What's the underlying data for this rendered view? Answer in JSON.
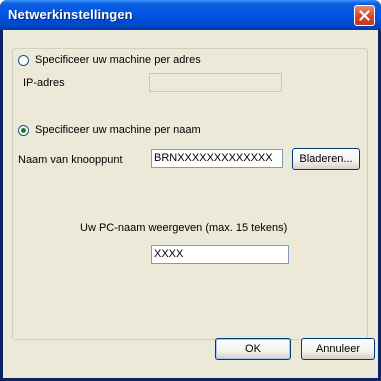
{
  "window": {
    "title": "Netwerkinstellingen"
  },
  "address_option": {
    "label": "Specificeer uw machine per adres",
    "selected": false
  },
  "ip": {
    "label": "IP-adres",
    "value": ""
  },
  "name_option": {
    "label": "Specificeer uw machine per naam",
    "selected": true
  },
  "node": {
    "label": "Naam van knooppunt",
    "value": "BRNXXXXXXXXXXXXX",
    "browse_label": "Bladeren..."
  },
  "pcname": {
    "label": "Uw PC-naam weergeven (max. 15 tekens)",
    "value": "XXXX"
  },
  "buttons": {
    "ok": "OK",
    "cancel": "Annuleer"
  },
  "icons": {
    "close": "close-icon"
  }
}
